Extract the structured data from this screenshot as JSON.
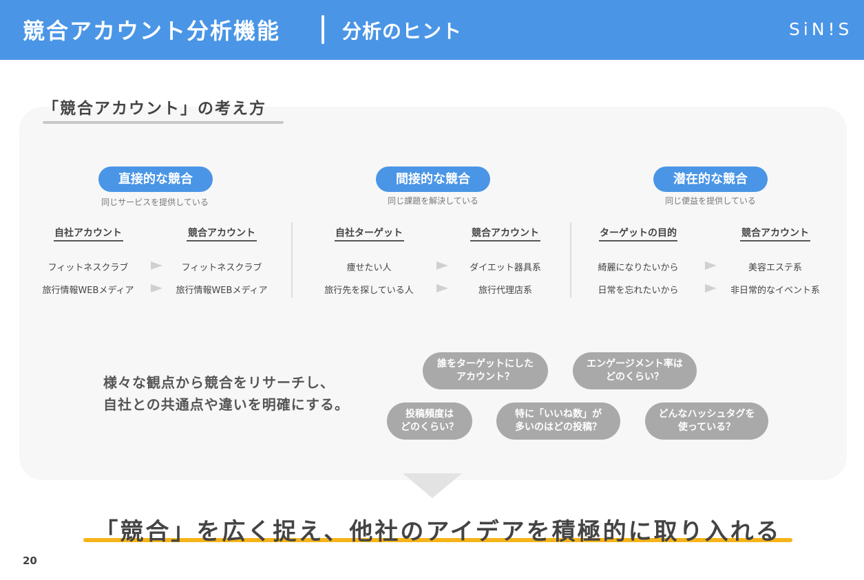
{
  "header": {
    "title": "競合アカウント分析機能",
    "subtitle": "分析のヒント",
    "logo": "SiN!S"
  },
  "section": {
    "title": "「競合アカウント」の考え方"
  },
  "categories": [
    {
      "label": "直接的な競合",
      "desc": "同じサービスを提供している",
      "left_head": "自社アカウント",
      "right_head": "競合アカウント",
      "rows": [
        {
          "left": "フィットネスクラブ",
          "right": "フィットネスクラブ"
        },
        {
          "left": "旅行情報WEBメディア",
          "right": "旅行情報WEBメディア"
        }
      ]
    },
    {
      "label": "間接的な競合",
      "desc": "同じ課題を解決している",
      "left_head": "自社ターゲット",
      "right_head": "競合アカウント",
      "rows": [
        {
          "left": "痩せたい人",
          "right": "ダイエット器具系"
        },
        {
          "left": "旅行先を探している人",
          "right": "旅行代理店系"
        }
      ]
    },
    {
      "label": "潜在的な競合",
      "desc": "同じ便益を提供している",
      "left_head": "ターゲットの目的",
      "right_head": "競合アカウント",
      "rows": [
        {
          "left": "綺麗になりたいから",
          "right": "美容エステ系"
        },
        {
          "left": "日常を忘れたいから",
          "right": "非日常的なイベント系"
        }
      ]
    }
  ],
  "research": {
    "line1": "様々な観点から競合をリサーチし、",
    "line2": "自社との共通点や違いを明確にする。"
  },
  "bubbles": [
    {
      "line1": "誰をターゲットにした",
      "line2": "アカウント？"
    },
    {
      "line1": "エンゲージメント率は",
      "line2": "どのくらい？"
    },
    {
      "line1": "投稿頻度は",
      "line2": "どのくらい？"
    },
    {
      "line1": "特に「いいね数」が",
      "line2": "多いのはどの投稿？"
    },
    {
      "line1": "どんなハッシュタグを",
      "line2": "使っている？"
    }
  ],
  "conclusion": "「競合」を広く捉え、他社のアイデアを積極的に取り入れる",
  "page_number": "20",
  "colors": {
    "primary": "#4a95e6",
    "accent": "#f5b41a",
    "bubble": "#a9a9a9"
  }
}
